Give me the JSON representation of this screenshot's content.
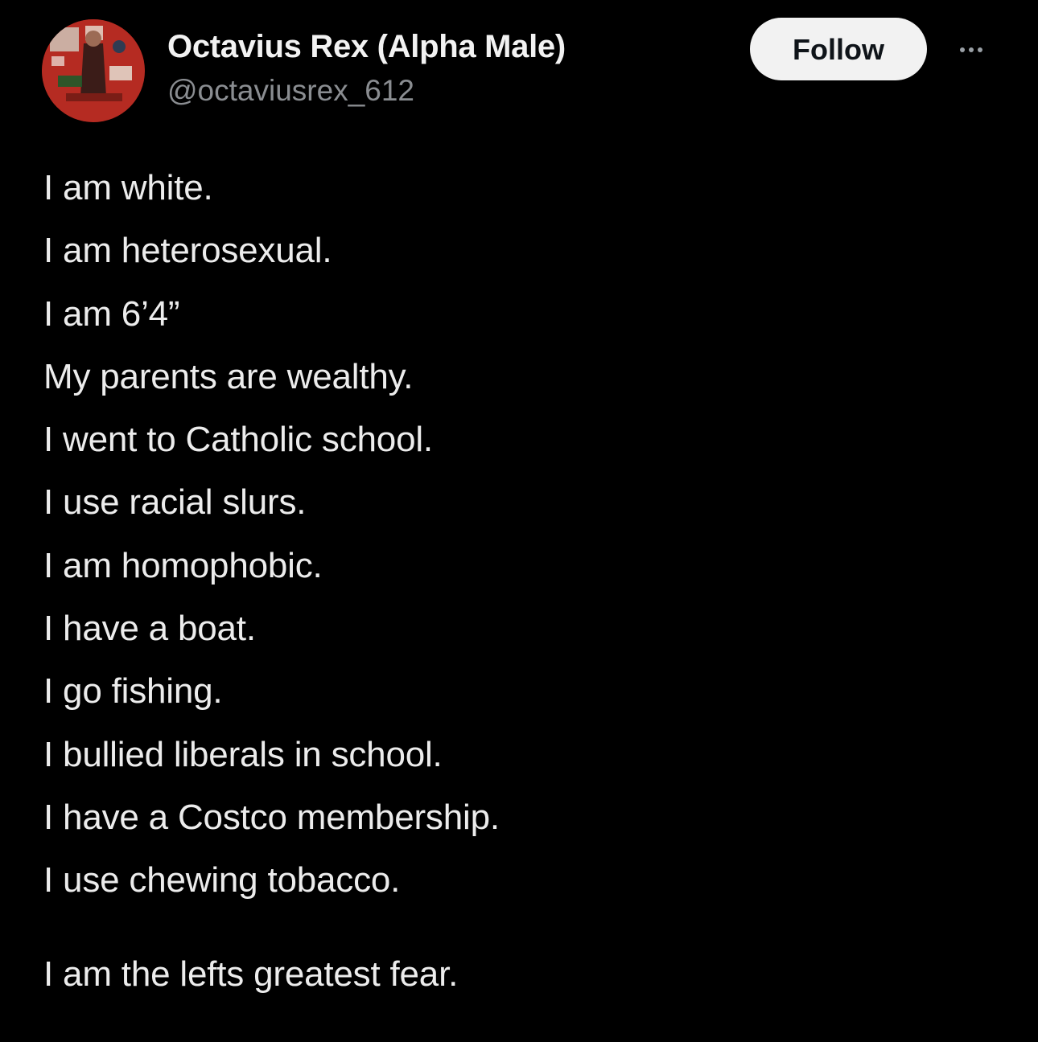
{
  "author": {
    "display_name": "Octavius Rex (Alpha Male)",
    "handle": "@octaviusrex_612",
    "avatar_icon": "avatar-image"
  },
  "actions": {
    "follow_label": "Follow",
    "more_icon": "more-options-icon"
  },
  "post": {
    "lines": [
      "I am white.",
      "I am heterosexual.",
      "I am 6’4”",
      "My parents are wealthy.",
      "I went to Catholic school.",
      "I use racial slurs.",
      "I am homophobic.",
      "I have a boat.",
      "I go fishing.",
      "I bullied liberals in school.",
      "I have a Costco membership.",
      "I use chewing tobacco."
    ],
    "closing": "I am the lefts greatest fear."
  },
  "colors": {
    "background": "#000000",
    "text": "#ececec",
    "handle": "#8a8d91",
    "follow_bg": "#f2f2f2",
    "follow_text": "#0f1419",
    "avatar_red": "#b02a20"
  }
}
